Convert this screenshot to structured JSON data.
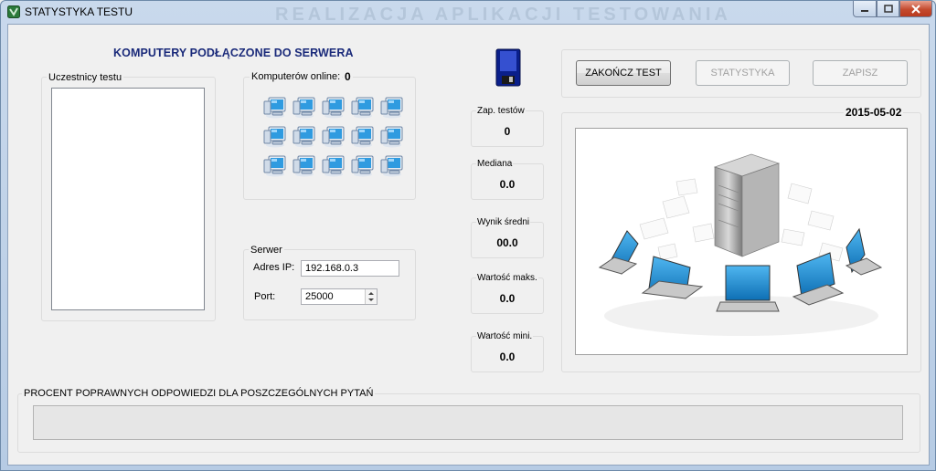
{
  "window": {
    "title": "STATYSTYKA TESTU",
    "title_ghost": "REALIZACJA APLIKACJI TESTOWANIA"
  },
  "header": {
    "main_title": "KOMPUTERY PODŁĄCZONE DO SERWERA"
  },
  "participants": {
    "label": "Uczestnicy testu",
    "items": []
  },
  "computers": {
    "online_label": "Komputerów online:",
    "online_count": "0",
    "icon": "computer-monitor-icon",
    "icon_count": 15
  },
  "server": {
    "group_label": "Serwer",
    "ip_label": "Adres IP:",
    "ip_value": "192.168.0.3",
    "port_label": "Port:",
    "port_value": "25000"
  },
  "save_icon": "floppy-disk-icon",
  "stats": {
    "tests_label": "Zap. testów",
    "tests_value": "0",
    "median_label": "Mediana",
    "median_value": "0.0",
    "average_label": "Wynik średni",
    "average_value": "00.0",
    "max_label": "Wartość maks.",
    "max_value": "0.0",
    "min_label": "Wartość mini.",
    "min_value": "0.0"
  },
  "toolbar": {
    "end_test_label": "ZAKOŃCZ TEST",
    "statistics_label": "STATYSTYKA",
    "save_label": "ZAPISZ"
  },
  "date": "2015-05-02",
  "illustration": "server-network-illustration",
  "percent": {
    "label": "PROCENT POPRAWNYCH ODPOWIEDZI DLA POSZCZEGÓLNYCH PYTAŃ"
  },
  "colors": {
    "header_text": "#1a2a7a",
    "close_button": "#c44a2e",
    "screen_blue": "#1e90d8"
  }
}
